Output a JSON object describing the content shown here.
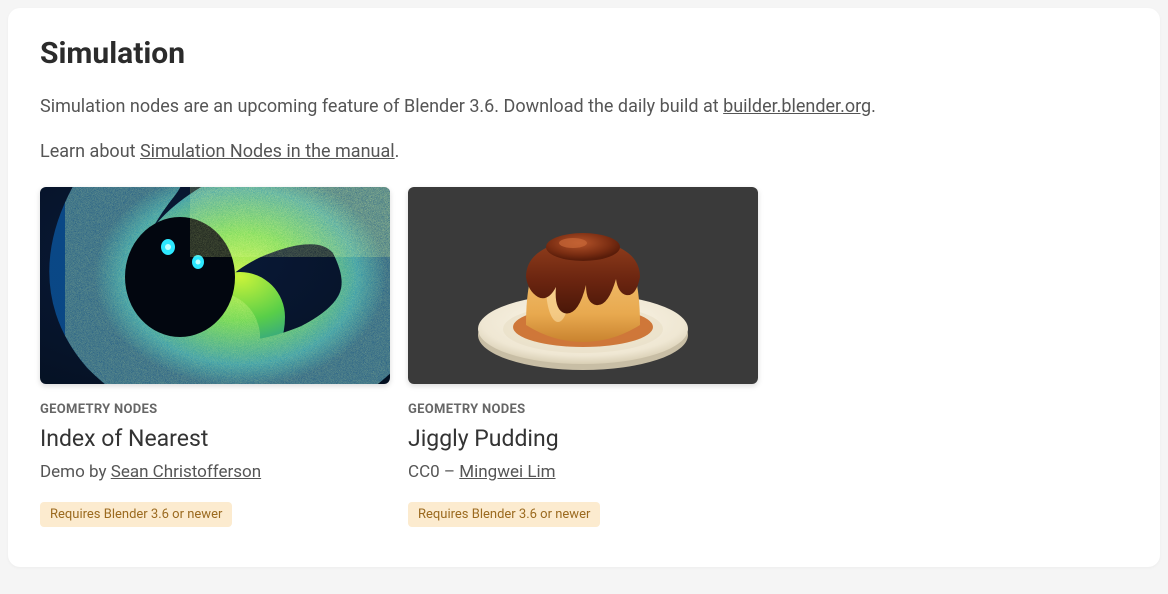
{
  "section": {
    "title": "Simulation",
    "desc_prefix": "Simulation nodes are an upcoming feature of Blender 3.6. Download the daily build at ",
    "desc_link": "builder.blender.org",
    "desc_suffix": ".",
    "learn_prefix": "Learn about ",
    "learn_link": "Simulation Nodes in the manual",
    "learn_suffix": "."
  },
  "items": [
    {
      "category": "GEOMETRY NODES",
      "title": "Index of Nearest",
      "credit_prefix": "Demo by ",
      "credit_link": "Sean Christofferson",
      "credit_suffix": "",
      "badge": "Requires Blender 3.6 or newer"
    },
    {
      "category": "GEOMETRY NODES",
      "title": "Jiggly Pudding",
      "credit_prefix": "CC0 – ",
      "credit_link": "Mingwei Lim",
      "credit_suffix": "",
      "badge": "Requires Blender 3.6 or newer"
    }
  ]
}
